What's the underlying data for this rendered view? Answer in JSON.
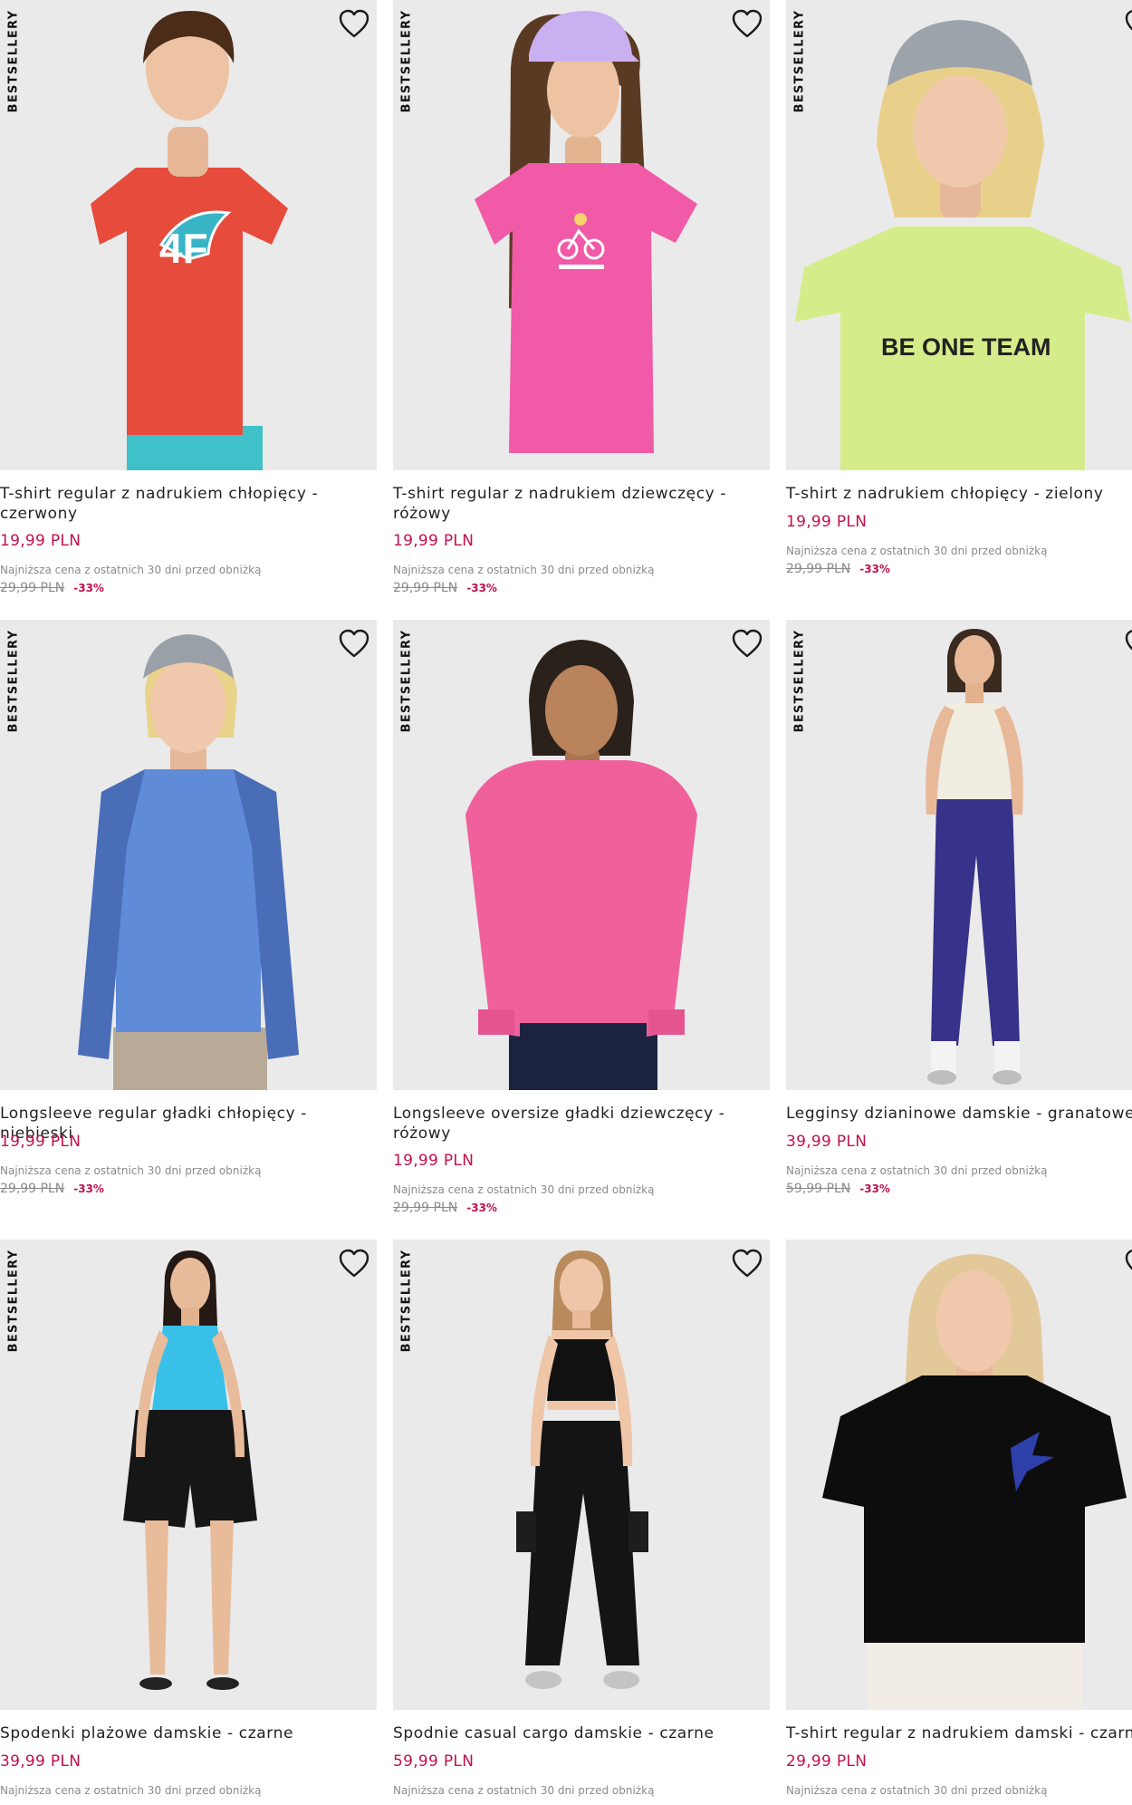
{
  "badge_text": "BESTSELLERY",
  "favorite_icon": "heart-icon",
  "colors": {
    "price": "#c1114b",
    "muted": "#8b8b8b",
    "photo_bg": "#ebebeb"
  },
  "products": [
    {
      "name": "T-shirt regular z nadrukiem chłopięcy - czerwony",
      "price": "19,99 PLN",
      "lowest_note": "Najniższa cena z ostatnich 30 dni przed obniżką",
      "prev_price": "29,99 PLN",
      "discount": "-33%",
      "badge": true
    },
    {
      "name": "T-shirt regular z nadrukiem dziewczęcy - różowy",
      "price": "19,99 PLN",
      "lowest_note": "Najniższa cena z ostatnich 30 dni przed obniżką",
      "prev_price": "29,99 PLN",
      "discount": "-33%",
      "badge": true
    },
    {
      "name": "T-shirt z nadrukiem chłopięcy - zielony",
      "price": "19,99 PLN",
      "lowest_note": "Najniższa cena z ostatnich 30 dni przed obniżką",
      "prev_price": "29,99 PLN",
      "discount": "-33%",
      "badge": true,
      "print_text": "BE ONE TEAM"
    },
    {
      "name": "Longsleeve regular gładki chłopięcy - niebieski",
      "price": "19,99 PLN",
      "lowest_note": "Najniższa cena z ostatnich 30 dni przed obniżką",
      "prev_price": "29,99 PLN",
      "discount": "-33%",
      "badge": true
    },
    {
      "name": "Longsleeve oversize gładki dziewczęcy - różowy",
      "price": "19,99 PLN",
      "lowest_note": "Najniższa cena z ostatnich 30 dni przed obniżką",
      "prev_price": "29,99 PLN",
      "discount": "-33%",
      "badge": true
    },
    {
      "name": "Legginsy dzianinowe damskie - granatowe",
      "price": "39,99 PLN",
      "lowest_note": "Najniższa cena z ostatnich 30 dni przed obniżką",
      "prev_price": "59,99 PLN",
      "discount": "-33%",
      "badge": true
    },
    {
      "name": "Spodenki plażowe damskie - czarne",
      "price": "39,99 PLN",
      "lowest_note": "Najniższa cena z ostatnich 30 dni przed obniżką",
      "badge": true
    },
    {
      "name": "Spodnie casual cargo damskie - czarne",
      "price": "59,99 PLN",
      "lowest_note": "Najniższa cena z ostatnich 30 dni przed obniżką",
      "badge": true
    },
    {
      "name": "T-shirt regular z nadrukiem damski - czarny",
      "price": "29,99 PLN",
      "lowest_note": "Najniższa cena z ostatnich 30 dni przed obniżką",
      "badge": false
    }
  ]
}
